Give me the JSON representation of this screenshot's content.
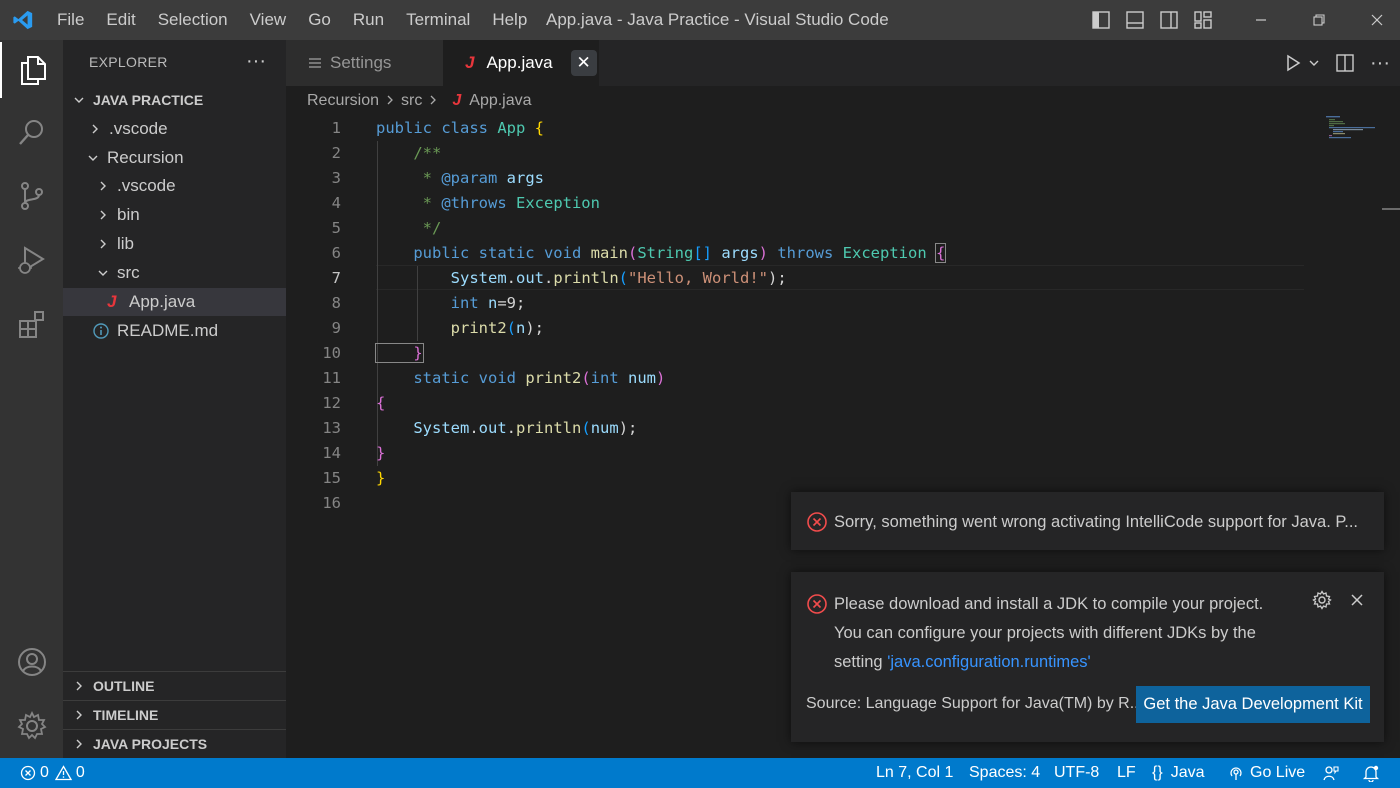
{
  "titlebar": {
    "menu": [
      "File",
      "Edit",
      "Selection",
      "View",
      "Go",
      "Run",
      "Terminal",
      "Help"
    ],
    "window_title": "App.java - Java Practice - Visual Studio Code"
  },
  "activitybar": {
    "items": [
      "explorer-icon",
      "search-icon",
      "source-control-icon",
      "run-debug-icon",
      "extensions-icon"
    ],
    "bottom": [
      "account-icon",
      "manage-gear-icon"
    ]
  },
  "sidebar": {
    "title": "EXPLORER",
    "more": "···",
    "root": "JAVA PRACTICE",
    "items": [
      {
        "label": ".vscode",
        "icon": "chevron-right"
      },
      {
        "label": "Recursion",
        "icon": "chevron-down"
      },
      {
        "label": ".vscode",
        "icon": "chevron-right"
      },
      {
        "label": "bin",
        "icon": "chevron-right"
      },
      {
        "label": "lib",
        "icon": "chevron-right"
      },
      {
        "label": "src",
        "icon": "chevron-down"
      },
      {
        "label": "App.java",
        "icon": "java-file"
      },
      {
        "label": "README.md",
        "icon": "info"
      }
    ],
    "sections": [
      "OUTLINE",
      "TIMELINE",
      "JAVA PROJECTS"
    ]
  },
  "tabs": [
    {
      "label": "Settings",
      "active": false
    },
    {
      "label": "App.java",
      "active": true,
      "close": "✕"
    }
  ],
  "breadcrumb": {
    "items": [
      "Recursion",
      "src",
      "App.java"
    ]
  },
  "editor": {
    "current_line": 7,
    "lines": [
      "1",
      "2",
      "3",
      "4",
      "5",
      "6",
      "7",
      "8",
      "9",
      "10",
      "11",
      "12",
      "13",
      "14",
      "15",
      "16"
    ],
    "code": {
      "l1": {
        "a": "public class ",
        "b": "App",
        "c": " {"
      },
      "l2": {
        "a": "    /**"
      },
      "l3": {
        "a": "     * ",
        "b": "@param",
        "c": " args"
      },
      "l4": {
        "a": "     * ",
        "b": "@throws",
        "c": " Exception"
      },
      "l5": {
        "a": "     */"
      },
      "l6": {
        "a": "    public static void ",
        "b": "main",
        "c": "(",
        "d": "String",
        "e": "[]",
        "f": " args",
        "g": ") ",
        "h": "throws",
        "i": " Exception",
        "j": " ",
        "k": "{"
      },
      "l7": {
        "a": "        System",
        "b": ".",
        "c": "out",
        "d": ".",
        "e": "println",
        "f": "(",
        "g": "\"Hello, World!\"",
        "h": ");"
      },
      "l8": {
        "a": "        int",
        "b": " n",
        "c": "=9;"
      },
      "l9": {
        "a": "        print2",
        "b": "(",
        "c": "n",
        "d": ");"
      },
      "l10": {
        "a": "    }"
      },
      "l11": {
        "a": "    static void ",
        "b": "print2",
        "c": "(",
        "d": "int",
        "e": " num",
        "f": ")"
      },
      "l12": {
        "a": "{"
      },
      "l13": {
        "a": "    System",
        "b": ".",
        "c": "out",
        "d": ".",
        "e": "println",
        "f": "(",
        "g": "num",
        "h": ");"
      },
      "l14": {
        "a": "}"
      },
      "l15": {
        "a": "}"
      }
    }
  },
  "notifications": {
    "first": {
      "message": "Sorry, something went wrong activating IntelliCode support for Java. P..."
    },
    "second": {
      "line1": "Please download and install a JDK to compile your project.",
      "line2": "You can configure your projects with different JDKs by the",
      "line3_prefix": "setting ",
      "line3_link": "'java.configuration.runtimes'",
      "source": "Source: Language Support for Java(TM) by R...",
      "button": "Get the Java Development Kit"
    }
  },
  "statusbar": {
    "errors": "0",
    "warnings": "0",
    "position": "Ln 7, Col 1",
    "spaces": "Spaces: 4",
    "encoding": "UTF-8",
    "eol": "LF",
    "language": "Java",
    "golive": "Go Live"
  },
  "colors": {
    "statusbar": "#007acc",
    "activitybar": "#333333",
    "sidebar": "#252526",
    "editor": "#1e1e1e",
    "button": "#0e639c"
  }
}
